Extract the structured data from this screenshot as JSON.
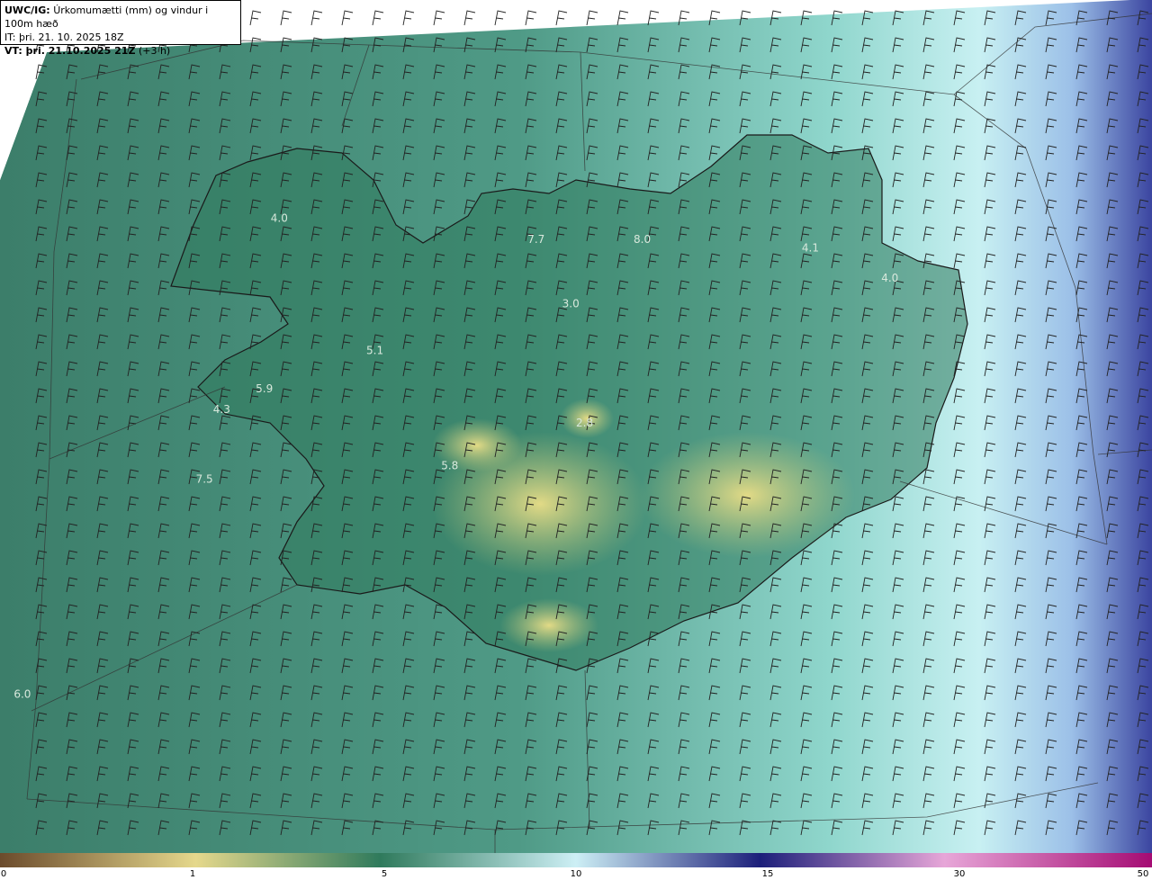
{
  "header": {
    "model": "UWC/IG:",
    "title": "Úrkomumætti (mm) og vindur i 100m hæð",
    "it_label": "IT:",
    "it_value": "þri. 21. 10. 2025 18Z",
    "vt_label": "VT: þri. 21.10.2025 21Z",
    "vt_offset": "(+3 h)"
  },
  "value_labels": [
    {
      "text": "4.0",
      "map_x": 0.235,
      "map_y": 0.26
    },
    {
      "text": "7.7",
      "map_x": 0.458,
      "map_y": 0.285
    },
    {
      "text": "8.0",
      "map_x": 0.55,
      "map_y": 0.285
    },
    {
      "text": "4.1",
      "map_x": 0.696,
      "map_y": 0.295
    },
    {
      "text": "4.0",
      "map_x": 0.765,
      "map_y": 0.33
    },
    {
      "text": "3.0",
      "map_x": 0.488,
      "map_y": 0.36
    },
    {
      "text": "5.1",
      "map_x": 0.318,
      "map_y": 0.415
    },
    {
      "text": "5.9",
      "map_x": 0.222,
      "map_y": 0.46
    },
    {
      "text": "4.3",
      "map_x": 0.185,
      "map_y": 0.484
    },
    {
      "text": "2.8",
      "map_x": 0.5,
      "map_y": 0.5
    },
    {
      "text": "5.8",
      "map_x": 0.383,
      "map_y": 0.55
    },
    {
      "text": "7.5",
      "map_x": 0.17,
      "map_y": 0.566
    },
    {
      "text": "6.0",
      "map_x": 0.012,
      "map_y": 0.818
    }
  ],
  "colorbar": {
    "ticks": [
      "0",
      "1",
      "5",
      "10",
      "15",
      "30",
      "50"
    ],
    "colors": [
      "#7a5a3a",
      "#b89a58",
      "#e6d985",
      "#3e8a60",
      "#86cfc0",
      "#cfeff6",
      "#9cb8e6",
      "#2a2f8e",
      "#8a3a9a",
      "#e6a6d6",
      "#b0147a"
    ]
  },
  "field_colors": {
    "sea_west": "#3f8a70",
    "sea_east": "#bfe9ef",
    "land": "#2f7a5a",
    "dry": "#d8d27a",
    "far_east": "#3e4aa6"
  }
}
